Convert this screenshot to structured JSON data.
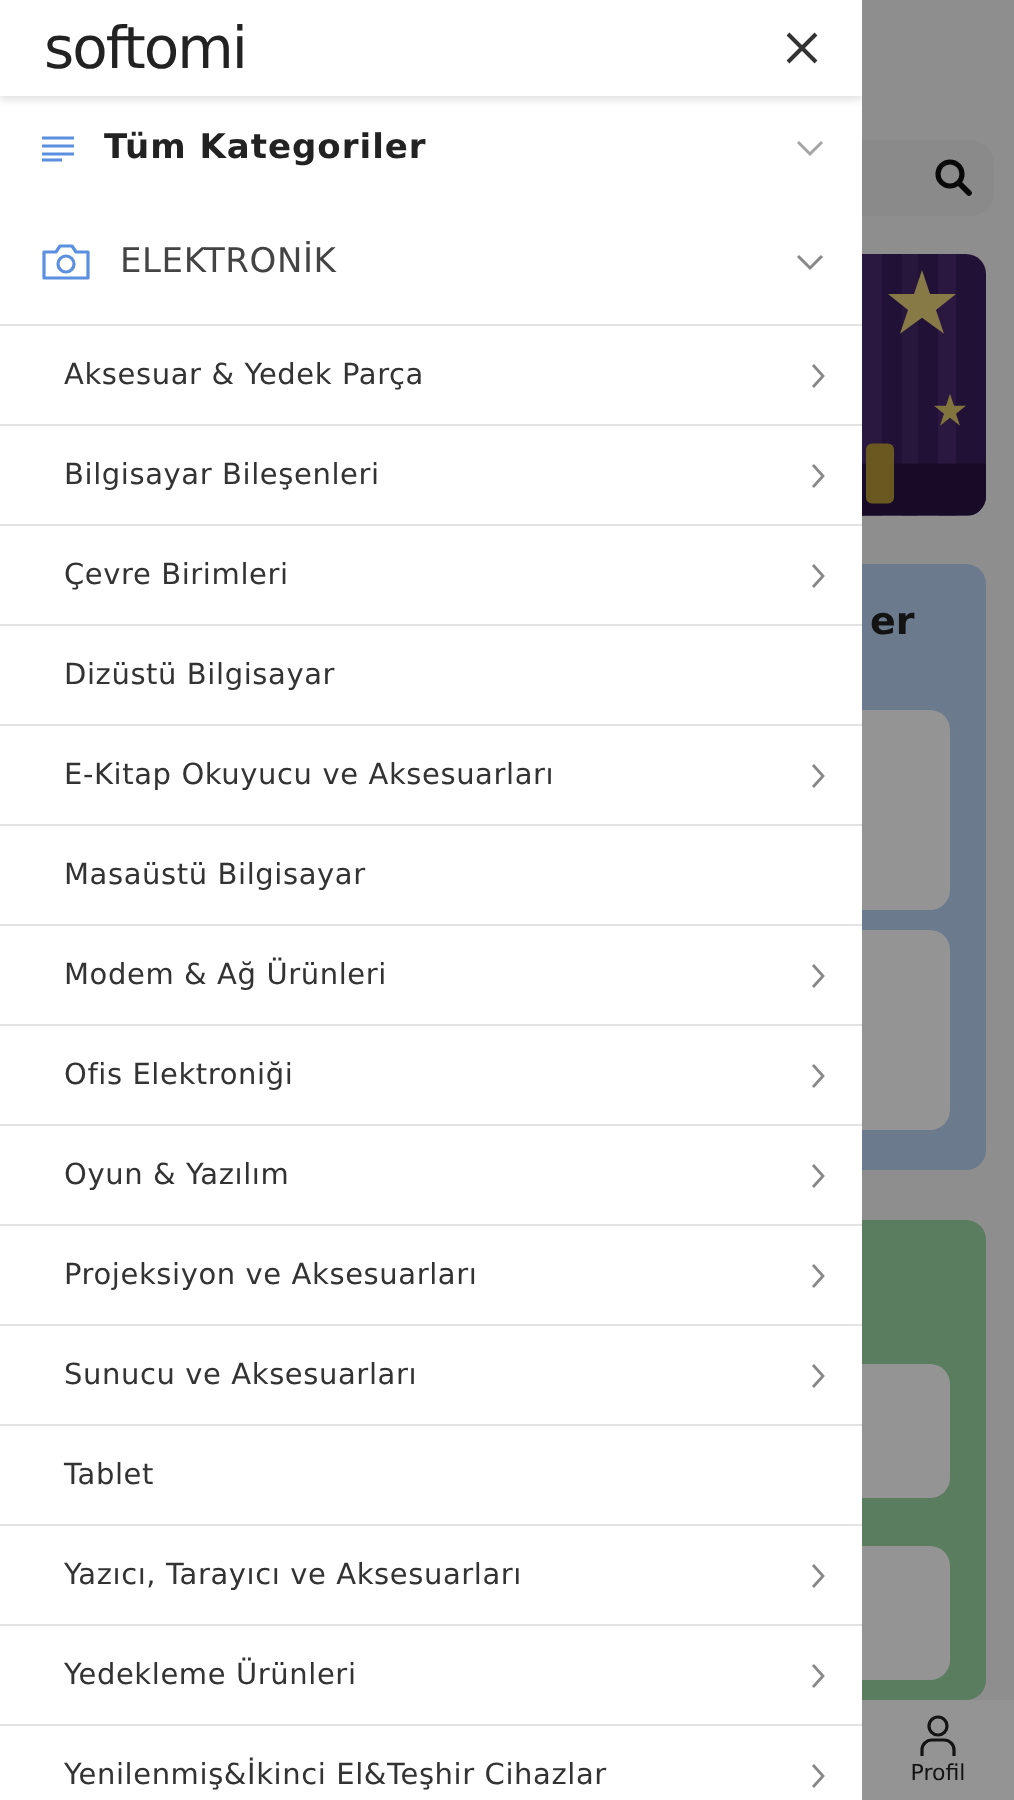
{
  "drawer": {
    "logo": "softomi",
    "all_categories": {
      "label": "Tüm Kategoriler",
      "expanded": false
    },
    "category": {
      "label": "ELEKTRONİK",
      "expanded": true
    },
    "items": [
      {
        "label": "Aksesuar & Yedek Parça",
        "has_children": true
      },
      {
        "label": "Bilgisayar Bileşenleri",
        "has_children": true
      },
      {
        "label": "Çevre Birimleri",
        "has_children": true
      },
      {
        "label": "Dizüstü Bilgisayar",
        "has_children": false
      },
      {
        "label": "E-Kitap Okuyucu ve Aksesuarları",
        "has_children": true
      },
      {
        "label": "Masaüstü Bilgisayar",
        "has_children": false
      },
      {
        "label": "Modem & Ağ Ürünleri",
        "has_children": true
      },
      {
        "label": "Ofis Elektroniği",
        "has_children": true
      },
      {
        "label": "Oyun & Yazılım",
        "has_children": true
      },
      {
        "label": "Projeksiyon ve Aksesuarları",
        "has_children": true
      },
      {
        "label": "Sunucu ve Aksesuarları",
        "has_children": true
      },
      {
        "label": "Tablet",
        "has_children": false
      },
      {
        "label": "Yazıcı, Tarayıcı ve Aksesuarları",
        "has_children": true
      },
      {
        "label": "Yedekleme Ürünleri",
        "has_children": true
      },
      {
        "label": "Yenilenmiş&İkinci El&Teşhir Cihazlar",
        "has_children": true
      }
    ]
  },
  "background": {
    "section_title": "er",
    "nav": {
      "label": "Profil"
    }
  }
}
